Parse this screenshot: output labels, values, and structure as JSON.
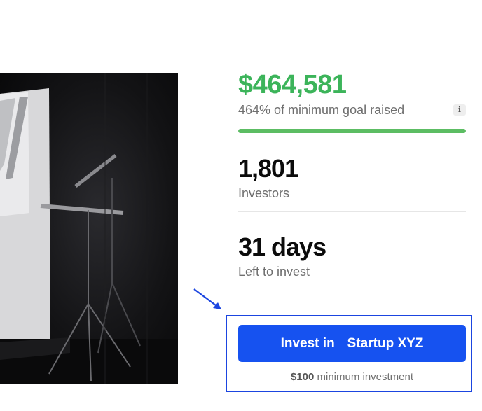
{
  "campaign": {
    "amount_raised": "$464,581",
    "goal_text": "464% of minimum goal raised",
    "info_icon": "i",
    "progress_percent": 100,
    "investors_count": "1,801",
    "investors_label": "Investors",
    "days_left": "31 days",
    "days_label": "Left to invest"
  },
  "cta": {
    "button_prefix": "Invest in",
    "button_company": "Startup XYZ",
    "min_amount": "$100",
    "min_label": "minimum investment"
  },
  "colors": {
    "amount_green": "#3cb45a",
    "progress_green": "#5cbd63",
    "button_blue": "#1652f0",
    "highlight_blue": "#1b45e0"
  },
  "icons": {
    "info": "info-icon",
    "annotation_arrow": "arrow-down-right-icon"
  }
}
